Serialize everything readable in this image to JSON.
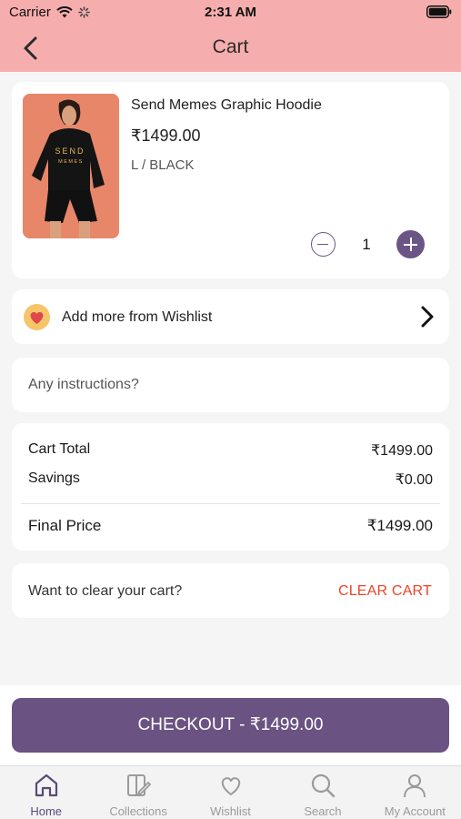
{
  "status_bar": {
    "carrier": "Carrier",
    "time": "2:31 AM"
  },
  "header": {
    "title": "Cart"
  },
  "cart_item": {
    "name": "Send Memes Graphic Hoodie",
    "price": "₹1499.00",
    "variant": "L / BLACK",
    "quantity": "1",
    "print_text_line1": "SEND",
    "print_text_line2": "MEMES"
  },
  "wishlist_row": {
    "label": "Add more from Wishlist"
  },
  "instructions": {
    "placeholder": "Any instructions?"
  },
  "totals": {
    "cart_total_label": "Cart Total",
    "cart_total_value": "₹1499.00",
    "savings_label": "Savings",
    "savings_value": "₹0.00",
    "final_label": "Final Price",
    "final_value": "₹1499.00"
  },
  "clear_cart": {
    "question": "Want to clear your cart?",
    "button": "CLEAR CART"
  },
  "checkout": {
    "label": "CHECKOUT - ₹1499.00"
  },
  "tabs": [
    {
      "label": "Home",
      "icon": "home-icon"
    },
    {
      "label": "Collections",
      "icon": "collections-icon"
    },
    {
      "label": "Wishlist",
      "icon": "heart-icon"
    },
    {
      "label": "Search",
      "icon": "search-icon"
    },
    {
      "label": "My Account",
      "icon": "user-icon"
    }
  ],
  "colors": {
    "header_bg": "#f6adad",
    "accent_purple": "#6a5282",
    "clear_red": "#e8462a",
    "wishlist_badge": "#f6c56a"
  }
}
